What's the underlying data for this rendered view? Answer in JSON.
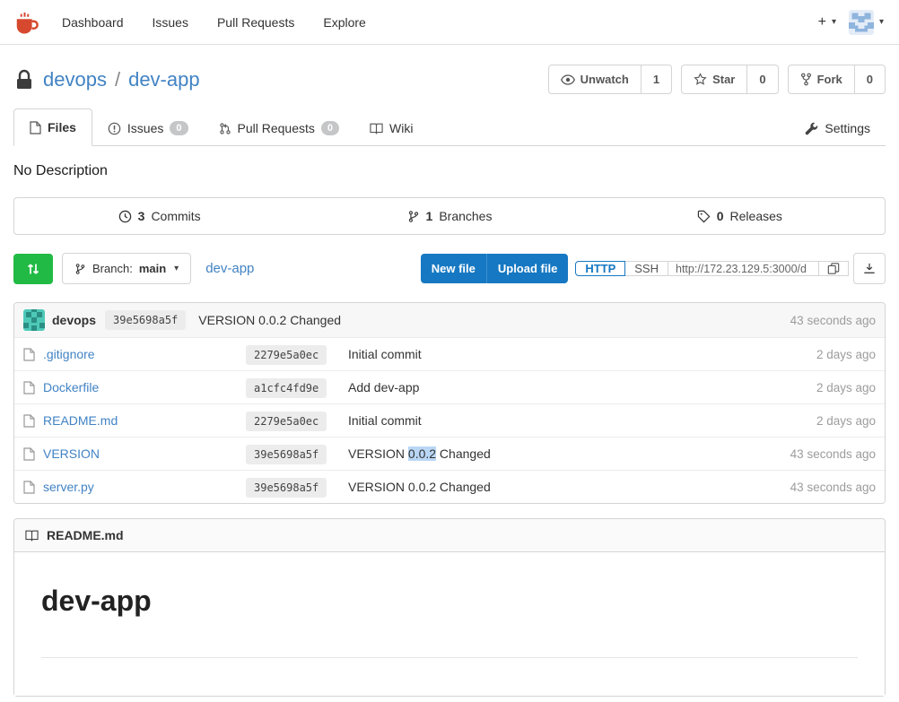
{
  "navbar": {
    "items": [
      {
        "label": "Dashboard"
      },
      {
        "label": "Issues"
      },
      {
        "label": "Pull Requests"
      },
      {
        "label": "Explore"
      }
    ],
    "plus": "+"
  },
  "repo": {
    "owner": "devops",
    "separator": "/",
    "name": "dev-app",
    "watch": {
      "label": "Unwatch",
      "count": "1"
    },
    "star": {
      "label": "Star",
      "count": "0"
    },
    "fork": {
      "label": "Fork",
      "count": "0"
    }
  },
  "tabs": {
    "files": "Files",
    "issues": "Issues",
    "issues_count": "0",
    "pulls": "Pull Requests",
    "pulls_count": "0",
    "wiki": "Wiki",
    "settings": "Settings"
  },
  "description": "No Description",
  "stats": {
    "commits_count": "3",
    "commits_label": "Commits",
    "branches_count": "1",
    "branches_label": "Branches",
    "releases_count": "0",
    "releases_label": "Releases"
  },
  "toolbar": {
    "branch_label": "Branch:",
    "branch_name": "main",
    "breadcrumb": "dev-app",
    "new_file": "New file",
    "upload_file": "Upload file",
    "http": "HTTP",
    "ssh": "SSH",
    "clone_url": "http://172.23.129.5:3000/d"
  },
  "latest_commit": {
    "author": "devops",
    "sha": "39e5698a5f",
    "message": "VERSION 0.0.2 Changed",
    "time": "43 seconds ago"
  },
  "files": [
    {
      "name": ".gitignore",
      "sha": "2279e5a0ec",
      "msg_pre": "Initial commit",
      "msg_hl": "",
      "msg_post": "",
      "time": "2 days ago"
    },
    {
      "name": "Dockerfile",
      "sha": "a1cfc4fd9e",
      "msg_pre": "Add dev-app",
      "msg_hl": "",
      "msg_post": "",
      "time": "2 days ago"
    },
    {
      "name": "README.md",
      "sha": "2279e5a0ec",
      "msg_pre": "Initial commit",
      "msg_hl": "",
      "msg_post": "",
      "time": "2 days ago"
    },
    {
      "name": "VERSION",
      "sha": "39e5698a5f",
      "msg_pre": "VERSION ",
      "msg_hl": "0.0.2",
      "msg_post": " Changed",
      "time": "43 seconds ago"
    },
    {
      "name": "server.py",
      "sha": "39e5698a5f",
      "msg_pre": "VERSION 0.0.2 Changed",
      "msg_hl": "",
      "msg_post": "",
      "time": "43 seconds ago"
    }
  ],
  "readme": {
    "filename": "README.md",
    "heading": "dev-app"
  },
  "colors": {
    "link_blue": "#4183c4",
    "button_blue": "#1678c2",
    "green": "#21ba45",
    "logo_orange": "#d6492f",
    "highlight": "#b9d7f5"
  }
}
